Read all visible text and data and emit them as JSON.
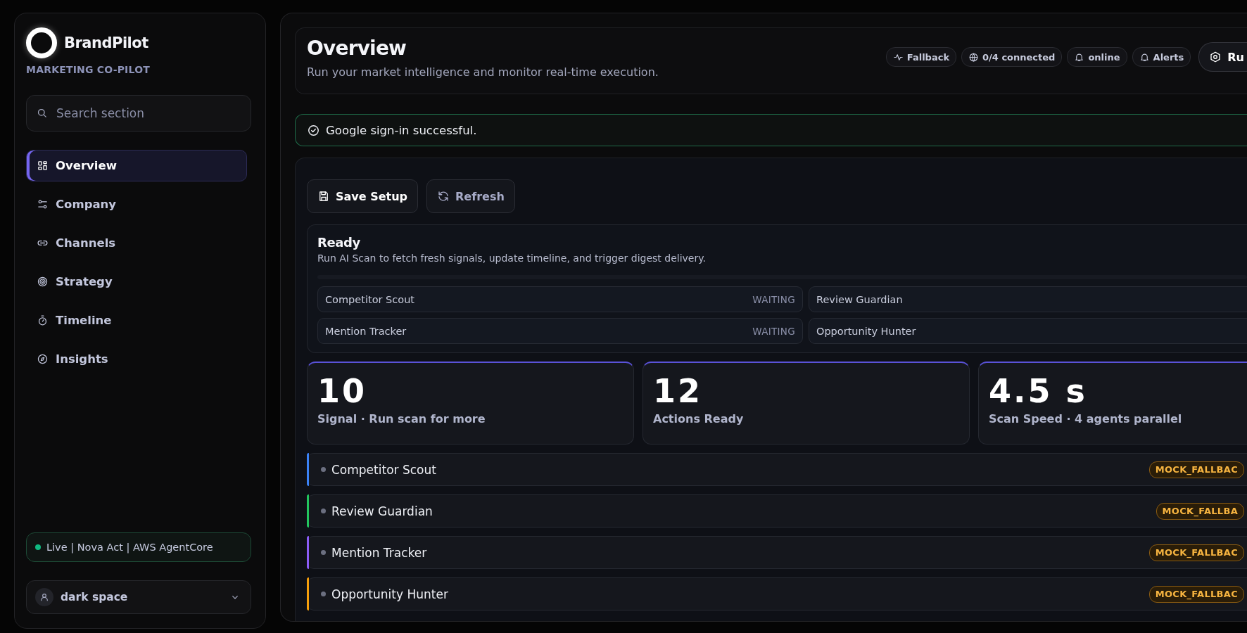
{
  "sidebar": {
    "brand": "BrandPilot",
    "tagline": "MARKETING CO-PILOT",
    "search": {
      "placeholder": "Search section"
    },
    "nav": [
      {
        "label": "Overview",
        "selected": true
      },
      {
        "label": "Company",
        "selected": false
      },
      {
        "label": "Channels",
        "selected": false
      },
      {
        "label": "Strategy",
        "selected": false
      },
      {
        "label": "Timeline",
        "selected": false
      },
      {
        "label": "Insights",
        "selected": false
      }
    ],
    "live_status": "Live | Nova Act | AWS AgentCore",
    "user": "dark space"
  },
  "header": {
    "title": "Overview",
    "subtitle": "Run your market intelligence and monitor real-time execution.",
    "pills": [
      {
        "label": "Fallback"
      },
      {
        "label": "0/4 connected"
      },
      {
        "label": "online"
      },
      {
        "label": "Alerts"
      }
    ],
    "run_button": "Ru"
  },
  "toast": "Google sign-in successful.",
  "toolbar": [
    "Save Setup",
    "Refresh"
  ],
  "ready": {
    "title": "Ready",
    "text": "Run AI Scan to fetch fresh signals, update timeline, and trigger digest delivery.",
    "agents": [
      {
        "name": "Competitor Scout",
        "status": "WAITING"
      },
      {
        "name": "Review Guardian"
      },
      {
        "name": "Mention Tracker",
        "status": "WAITING"
      },
      {
        "name": "Opportunity Hunter"
      }
    ]
  },
  "stats": [
    {
      "value": "10",
      "label": "Signal · Run scan for more"
    },
    {
      "value": "12",
      "label": "Actions Ready"
    },
    {
      "value": "4.5 s",
      "label": "Scan Speed · 4 agents parallel"
    }
  ],
  "agent_rows": [
    {
      "name": "Competitor Scout",
      "color": "#3b82f6",
      "badge": "MOCK_FALLBAC"
    },
    {
      "name": "Review Guardian",
      "color": "#22c55e",
      "badge": "MOCK_FALLBA"
    },
    {
      "name": "Mention Tracker",
      "color": "#8b5cf6",
      "badge": "MOCK_FALLBAC"
    },
    {
      "name": "Opportunity Hunter",
      "color": "#f59e0b",
      "badge": "MOCK_FALLBAC"
    }
  ]
}
